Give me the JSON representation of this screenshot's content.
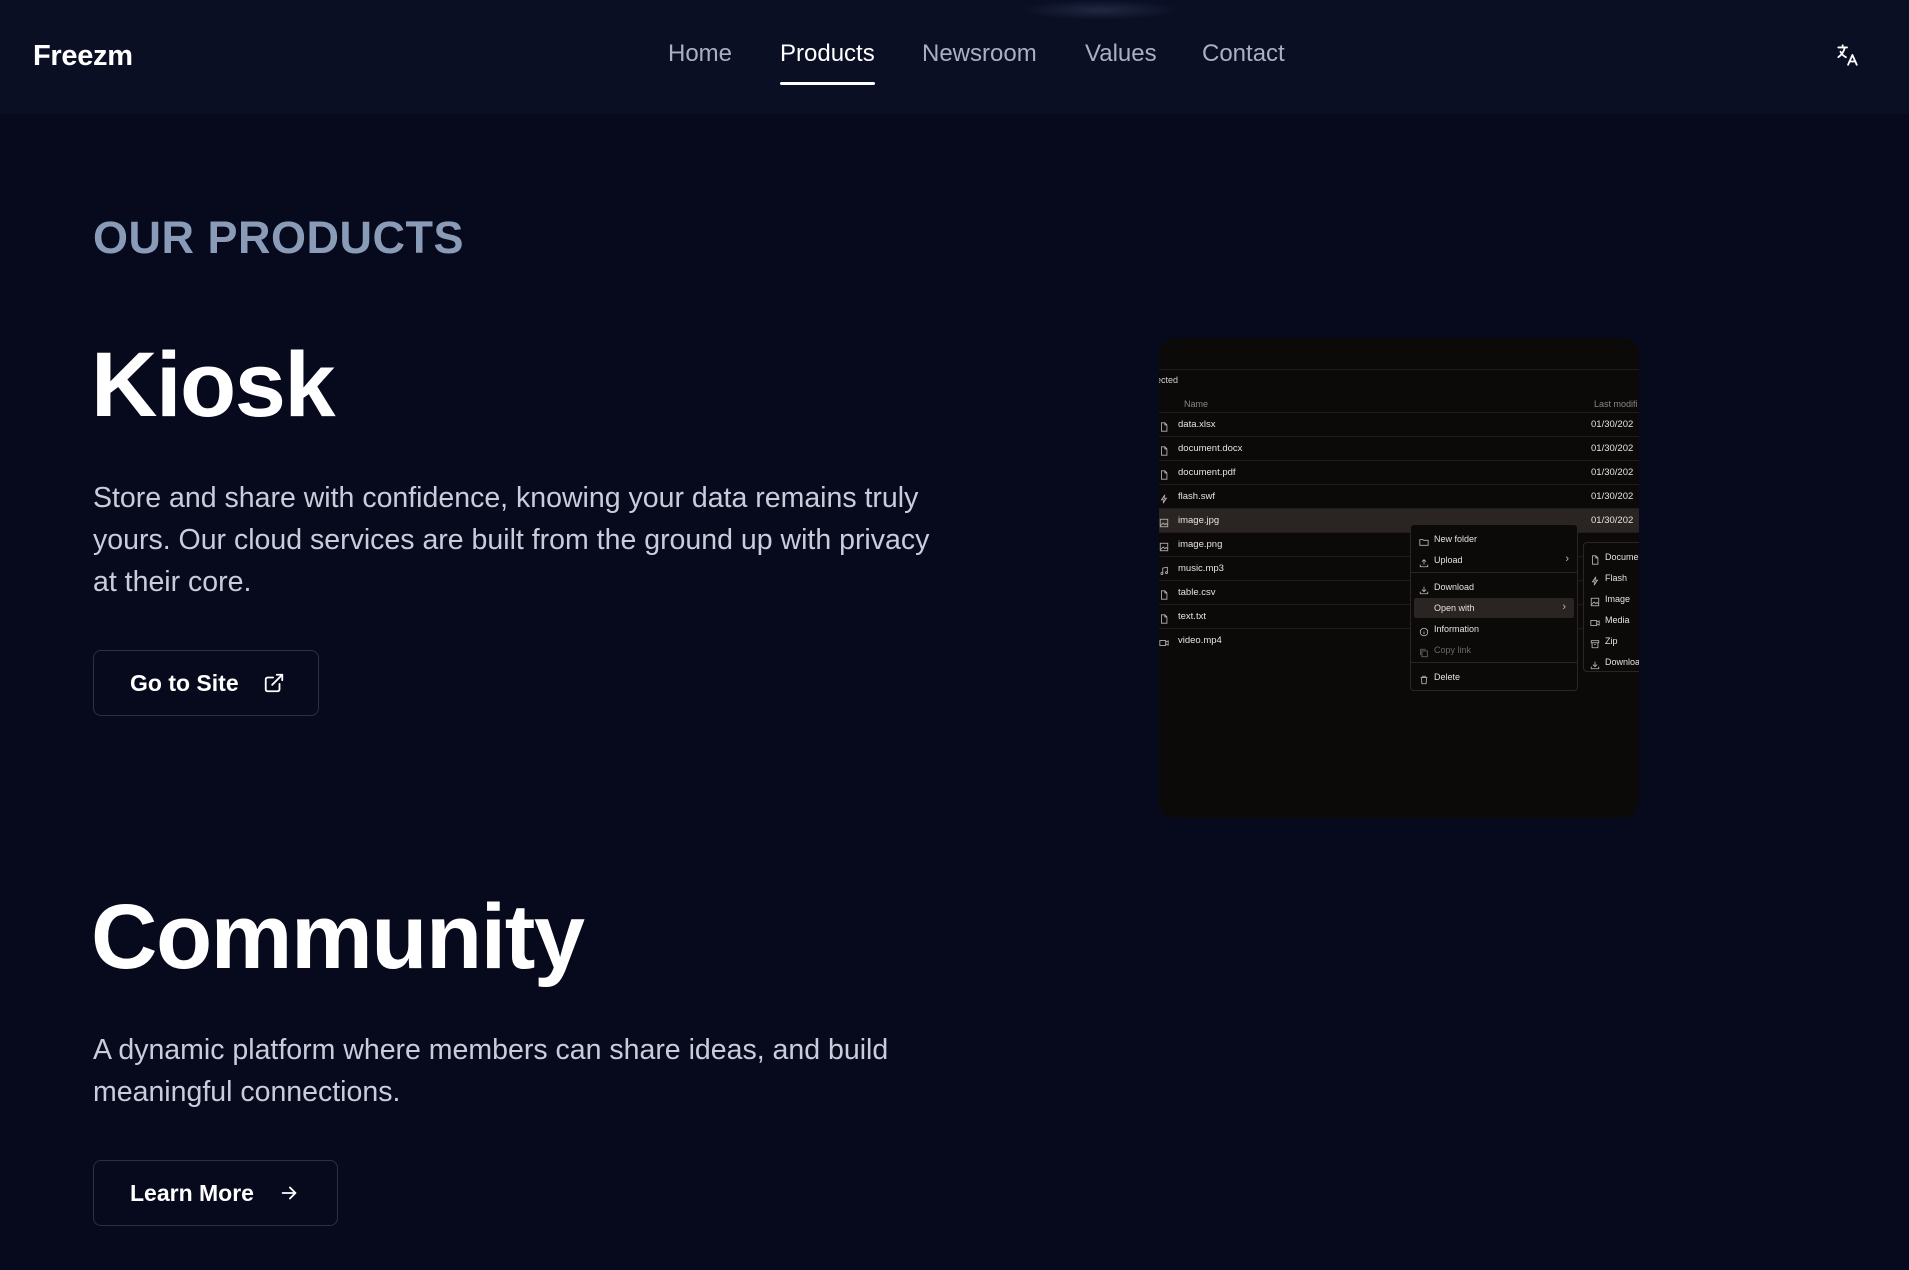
{
  "header": {
    "logo": "Freezm",
    "nav": [
      "Home",
      "Products",
      "Newsroom",
      "Values",
      "Contact"
    ],
    "active_nav": "Products",
    "translate_icon": "translate-icon"
  },
  "main": {
    "section_label": "OUR PRODUCTS",
    "products": [
      {
        "title": "Kiosk",
        "description": "Store and share with confidence, knowing your data remains truly yours. Our cloud services are built from the ground up with privacy at their core.",
        "cta_label": "Go to Site",
        "cta_icon": "external-link-icon"
      },
      {
        "title": "Community",
        "description": "A dynamic platform where members can share ideas, and build meaningful connections.",
        "cta_label": "Learn More",
        "cta_icon": "arrow-right-icon"
      }
    ]
  },
  "preview": {
    "selected_text": "ected",
    "columns": {
      "name": "Name",
      "modified": "Last modifi"
    },
    "files": [
      {
        "name": "data.xlsx",
        "date": "01/30/202",
        "icon": "file-icon"
      },
      {
        "name": "document.docx",
        "date": "01/30/202",
        "icon": "file-icon"
      },
      {
        "name": "document.pdf",
        "date": "01/30/202",
        "icon": "file-icon"
      },
      {
        "name": "flash.swf",
        "date": "01/30/202",
        "icon": "flash-icon"
      },
      {
        "name": "image.jpg",
        "date": "01/30/202",
        "icon": "image-icon"
      },
      {
        "name": "image.png",
        "date": "",
        "icon": "image-icon"
      },
      {
        "name": "music.mp3",
        "date": "",
        "icon": "music-icon"
      },
      {
        "name": "table.csv",
        "date": "",
        "icon": "file-icon"
      },
      {
        "name": "text.txt",
        "date": "",
        "icon": "file-icon"
      },
      {
        "name": "video.mp4",
        "date": "",
        "icon": "video-icon"
      }
    ],
    "context_menu": [
      {
        "label": "New folder",
        "icon": "folder-icon"
      },
      {
        "label": "Upload",
        "icon": "upload-icon",
        "submenu": true
      },
      {
        "label": "Download",
        "icon": "download-icon"
      },
      {
        "label": "Open with",
        "icon": "",
        "submenu": true,
        "selected": true
      },
      {
        "label": "Information",
        "icon": "info-icon"
      },
      {
        "label": "Copy link",
        "icon": "copy-icon",
        "disabled": true
      },
      {
        "label": "Delete",
        "icon": "trash-icon"
      }
    ],
    "submenu": [
      {
        "label": "Documen",
        "icon": "file-icon"
      },
      {
        "label": "Flash",
        "icon": "flash-icon"
      },
      {
        "label": "Image",
        "icon": "image-icon"
      },
      {
        "label": "Media",
        "icon": "video-icon"
      },
      {
        "label": "Zip",
        "icon": "archive-icon"
      },
      {
        "label": "Downloa",
        "icon": "download-icon"
      }
    ]
  },
  "colors": {
    "background": "#060a1c",
    "nav_background": "#0a0f24",
    "section_label": "#8a9bb8",
    "preview_background": "#0c0a09"
  }
}
